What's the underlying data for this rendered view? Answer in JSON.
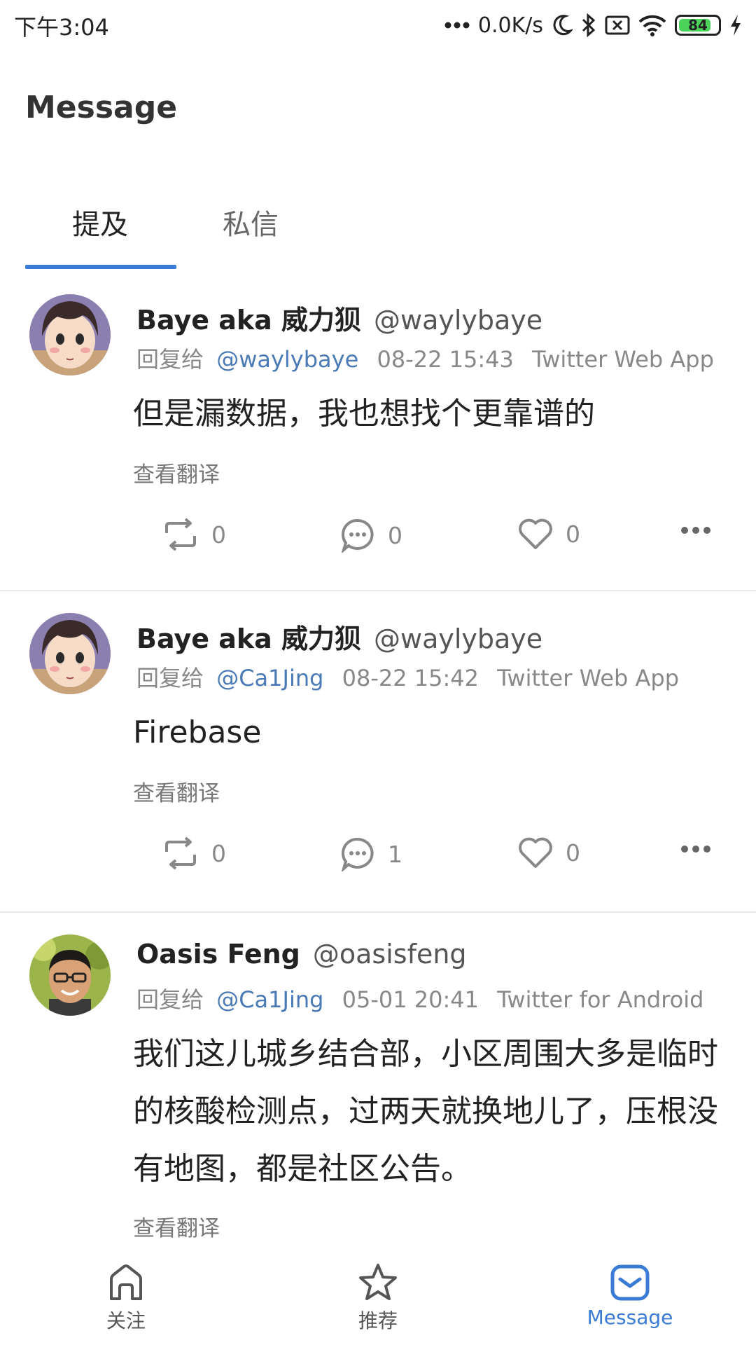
{
  "status_bar": {
    "time": "下午3:04",
    "net_speed": "0.0K/s",
    "battery_level": "84",
    "battery_fraction": 0.84,
    "icons": [
      "signal-dots-icon",
      "moon-icon",
      "bluetooth-icon",
      "sim-off-icon",
      "wifi-icon",
      "battery-icon",
      "charging-icon"
    ]
  },
  "header": {
    "title": "Message",
    "tabs": [
      {
        "label": "提及",
        "active": true
      },
      {
        "label": "私信",
        "active": false
      }
    ]
  },
  "tweets": [
    {
      "name": "Baye aka 威力狈",
      "handle": "@waylybaye",
      "reply_prefix": "回复给",
      "reply_to": "@waylybaye",
      "time": "08-22 15:43",
      "source": "Twitter Web App",
      "text": "但是漏数据，我也想找个更靠谱的",
      "translate": "查看翻译",
      "retweets": "0",
      "replies": "0",
      "likes": "0"
    },
    {
      "name": "Baye aka 威力狈",
      "handle": "@waylybaye",
      "reply_prefix": "回复给",
      "reply_to": "@Ca1Jing",
      "time": "08-22 15:42",
      "source": "Twitter Web App",
      "text": "Firebase",
      "translate": "查看翻译",
      "retweets": "0",
      "replies": "1",
      "likes": "0"
    },
    {
      "name": "Oasis Feng",
      "handle": "@oasisfeng",
      "reply_prefix": "回复给",
      "reply_to": "@Ca1Jing",
      "time": "05-01 20:41",
      "source": "Twitter for Android",
      "text": "我们这儿城乡结合部，小区周围大多是临时的核酸检测点，过两天就换地儿了，压根没有地图，都是社区公告。",
      "translate": "查看翻译"
    }
  ],
  "bottom_nav": [
    {
      "label": "关注",
      "icon": "home-icon",
      "active": false
    },
    {
      "label": "推荐",
      "icon": "star-icon",
      "active": false
    },
    {
      "label": "Message",
      "icon": "message-icon",
      "active": true
    }
  ],
  "colors": {
    "accent": "#3a7bd5",
    "link": "#4a7ab5",
    "muted": "#888888"
  }
}
